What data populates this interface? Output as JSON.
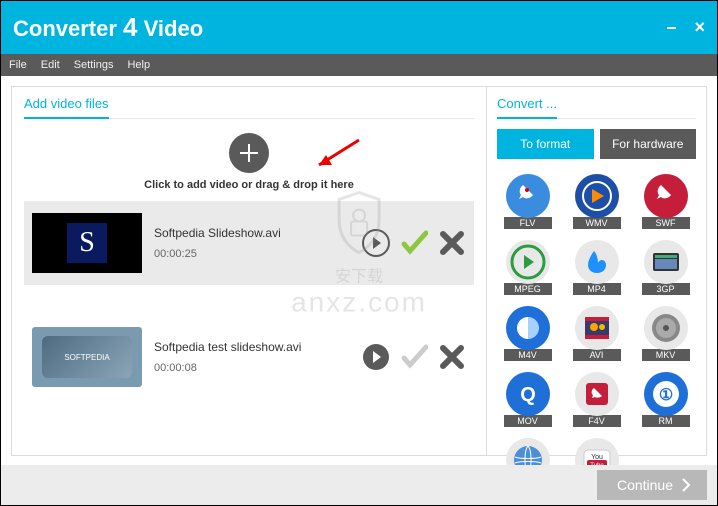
{
  "app": {
    "title_pre": "Converter",
    "title_num": "4",
    "title_post": "Video"
  },
  "menu": {
    "file": "File",
    "edit": "Edit",
    "settings": "Settings",
    "help": "Help"
  },
  "left": {
    "title": "Add video files",
    "add_hint": "Click to add video or drag & drop it here",
    "items": [
      {
        "name": "Softpedia Slideshow.avi",
        "duration": "00:00:25",
        "selected": true,
        "checked": true
      },
      {
        "name": "Softpedia test slideshow.avi",
        "duration": "00:00:08",
        "selected": false,
        "checked": false
      }
    ]
  },
  "right": {
    "title": "Convert ...",
    "tabs": {
      "format": "To format",
      "hardware": "For hardware"
    },
    "formats": [
      "FLV",
      "WMV",
      "SWF",
      "MPEG",
      "MP4",
      "3GP",
      "M4V",
      "AVI",
      "MKV",
      "MOV",
      "F4V",
      "RM",
      "Web",
      "Youtube"
    ]
  },
  "footer": {
    "continue": "Continue"
  },
  "watermark": {
    "text": "anxz.com",
    "sub": "安下载"
  },
  "colors": {
    "primary": "#00b4e0",
    "dark": "#5a5a5a"
  }
}
